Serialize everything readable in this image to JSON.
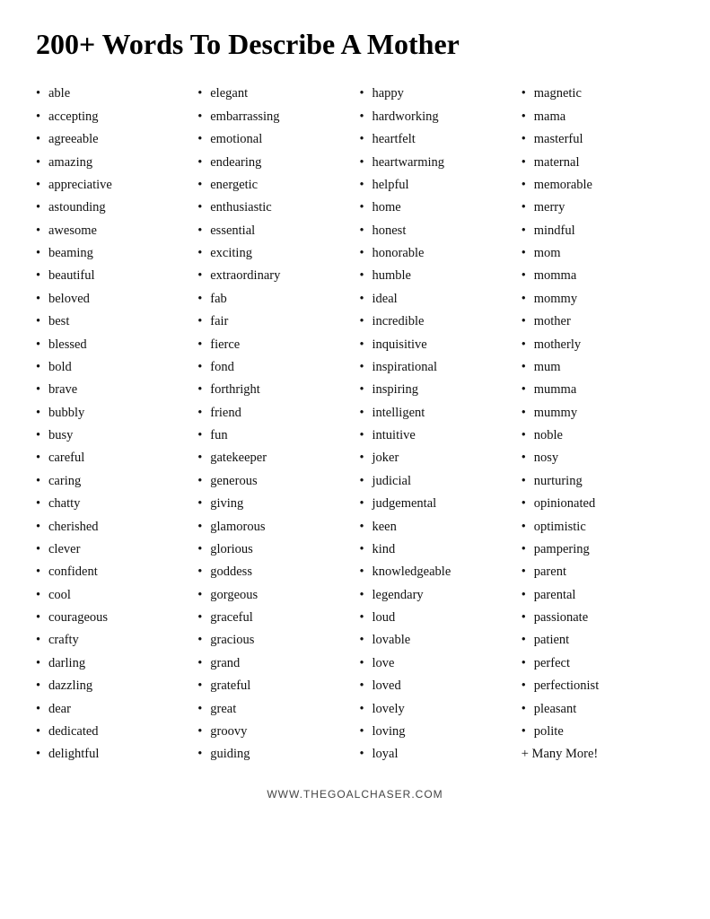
{
  "title": "200+ Words To Describe A Mother",
  "columns": [
    {
      "id": "col1",
      "words": [
        "able",
        "accepting",
        "agreeable",
        "amazing",
        "appreciative",
        "astounding",
        "awesome",
        "beaming",
        "beautiful",
        "beloved",
        "best",
        "blessed",
        "bold",
        "brave",
        "bubbly",
        "busy",
        "careful",
        "caring",
        "chatty",
        "cherished",
        "clever",
        "confident",
        "cool",
        "courageous",
        "crafty",
        "darling",
        "dazzling",
        "dear",
        "dedicated",
        "delightful"
      ]
    },
    {
      "id": "col2",
      "words": [
        "elegant",
        "embarrassing",
        "emotional",
        "endearing",
        "energetic",
        "enthusiastic",
        "essential",
        "exciting",
        "extraordinary",
        "fab",
        "fair",
        "fierce",
        "fond",
        "forthright",
        "friend",
        "fun",
        "gatekeeper",
        "generous",
        "giving",
        "glamorous",
        "glorious",
        "goddess",
        "gorgeous",
        "graceful",
        "gracious",
        "grand",
        "grateful",
        "great",
        "groovy",
        "guiding"
      ]
    },
    {
      "id": "col3",
      "words": [
        "happy",
        "hardworking",
        "heartfelt",
        "heartwarming",
        "helpful",
        "home",
        "honest",
        "honorable",
        "humble",
        " ideal",
        "incredible",
        "inquisitive",
        "inspirational",
        "inspiring",
        "intelligent",
        "intuitive",
        "joker",
        "judicial",
        "judgemental",
        "keen",
        "kind",
        "knowledgeable",
        "legendary",
        "loud",
        "lovable",
        "love",
        "loved",
        "lovely",
        "loving",
        "loyal"
      ]
    },
    {
      "id": "col4",
      "words": [
        "magnetic",
        "mama",
        "masterful",
        "maternal",
        "memorable",
        "merry",
        "mindful",
        "mom",
        "momma",
        "mommy",
        "mother",
        "motherly",
        "mum",
        "mumma",
        "mummy",
        "noble",
        "nosy",
        "nurturing",
        "opinionated",
        "optimistic",
        "pampering",
        "parent",
        "parental",
        "passionate",
        "patient",
        "perfect",
        "perfectionist",
        "pleasant",
        "polite",
        "+ Many More!"
      ]
    }
  ],
  "footer": "WWW.THEGOALCHASER.COM"
}
